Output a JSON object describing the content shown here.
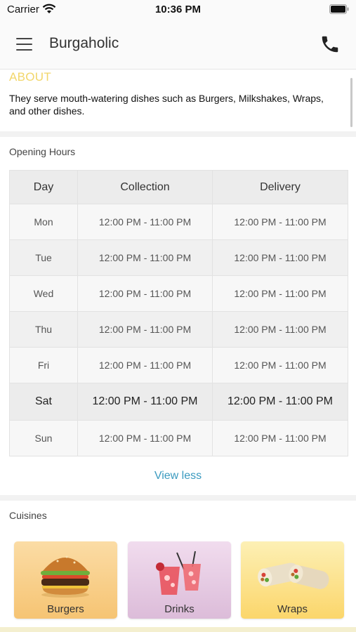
{
  "status_bar": {
    "carrier": "Carrier",
    "time": "10:36 PM"
  },
  "nav": {
    "title": "Burgaholic",
    "menu_icon": "hamburger-menu-icon",
    "phone_icon": "phone-icon"
  },
  "about": {
    "title": "ABOUT",
    "text": "They serve mouth-watering dishes such as Burgers, Milkshakes, Wraps, and other dishes."
  },
  "opening_hours": {
    "title": "Opening Hours",
    "headers": {
      "day": "Day",
      "collection": "Collection",
      "delivery": "Delivery"
    },
    "rows": [
      {
        "day": "Mon",
        "collection": "12:00 PM - 11:00 PM",
        "delivery": "12:00 PM - 11:00 PM"
      },
      {
        "day": "Tue",
        "collection": "12:00 PM - 11:00 PM",
        "delivery": "12:00 PM - 11:00 PM"
      },
      {
        "day": "Wed",
        "collection": "12:00 PM - 11:00 PM",
        "delivery": "12:00 PM - 11:00 PM"
      },
      {
        "day": "Thu",
        "collection": "12:00 PM - 11:00 PM",
        "delivery": "12:00 PM - 11:00 PM"
      },
      {
        "day": "Fri",
        "collection": "12:00 PM - 11:00 PM",
        "delivery": "12:00 PM - 11:00 PM"
      },
      {
        "day": "Sat",
        "collection": "12:00 PM - 11:00 PM",
        "delivery": "12:00 PM - 11:00 PM"
      },
      {
        "day": "Sun",
        "collection": "12:00 PM - 11:00 PM",
        "delivery": "12:00 PM - 11:00 PM"
      }
    ],
    "view_less": "View less"
  },
  "cuisines": {
    "title": "Cuisines",
    "items": [
      {
        "label": "Burgers",
        "icon": "burger-image"
      },
      {
        "label": "Drinks",
        "icon": "drinks-image"
      },
      {
        "label": "Wraps",
        "icon": "wraps-image"
      }
    ]
  },
  "colors": {
    "about_title": "#f2d66a",
    "link": "#3a9abf"
  }
}
